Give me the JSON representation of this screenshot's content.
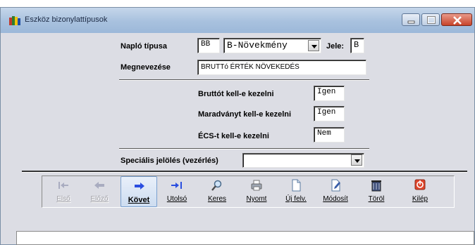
{
  "window": {
    "title": "Eszköz bizonylattípusok",
    "icon": "books-icon",
    "controls": [
      "minimize-icon",
      "maximize-icon",
      "close-icon"
    ]
  },
  "form": {
    "naplo_label": "Napló típusa",
    "naplo_code": "BB",
    "naplo_value": "B-Növekmény",
    "jele_label": "Jele:",
    "jele_value": "B",
    "megnevezes_label": "Megnevezése",
    "megnevezes_value": "BRUTTó ÉRTÉK NÖVEKEDÉS",
    "brutto_label": "Bruttót kell-e kezelni",
    "brutto_value": "Igen",
    "maradvany_label": "Maradványt kell-e kezelni",
    "maradvany_value": "Igen",
    "ecs_label": "ÉCS-t kell-e kezelni",
    "ecs_value": "Nem",
    "specialis_label": "Speciális jelölés (vezérlés)",
    "specialis_value": ""
  },
  "toolbar": {
    "buttons": [
      {
        "label": "Első",
        "icon": "first-icon",
        "state": "disabled"
      },
      {
        "label": "Előző",
        "icon": "previous-icon",
        "state": "disabled"
      },
      {
        "label": "Követ",
        "icon": "next-icon",
        "state": "active"
      },
      {
        "label": "Utolsó",
        "icon": "last-icon",
        "state": "normal"
      },
      {
        "label": "Keres",
        "icon": "search-icon",
        "state": "normal"
      },
      {
        "label": "Nyomt",
        "icon": "print-icon",
        "state": "normal"
      },
      {
        "label": "Új felv.",
        "icon": "new-document-icon",
        "state": "normal"
      },
      {
        "label": "Módosít",
        "icon": "edit-icon",
        "state": "normal"
      },
      {
        "label": "Töröl",
        "icon": "delete-icon",
        "state": "normal"
      },
      {
        "label": "Kilép",
        "icon": "exit-icon",
        "state": "normal"
      }
    ]
  },
  "colors": {
    "background": "#dcdde4",
    "accent_blue": "#2a4ee0",
    "exit_red": "#e0442a"
  }
}
